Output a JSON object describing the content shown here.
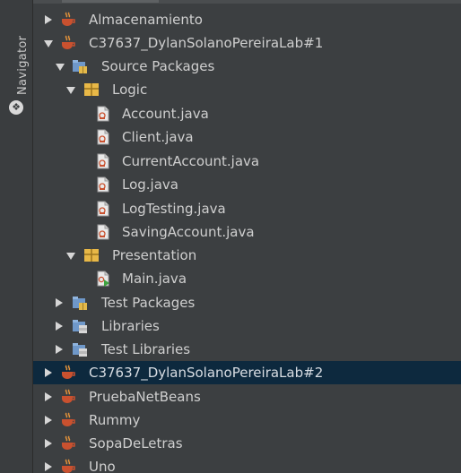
{
  "sidebar": {
    "navigator_label": "Navigator",
    "navigator_icon": "navigator-icon"
  },
  "tree": {
    "selected_color": "#0d293e",
    "items": [
      {
        "label": "Almacenamiento",
        "icon": "coffee-cup-icon",
        "expanded": false,
        "selected": false
      },
      {
        "label": "C37637_DylanSolanoPereiraLab#1",
        "icon": "coffee-cup-icon",
        "expanded": true,
        "selected": false
      },
      {
        "label": "Source Packages",
        "icon": "source-packages-icon",
        "expanded": true,
        "selected": false
      },
      {
        "label": "Logic",
        "icon": "package-icon",
        "expanded": true,
        "selected": false
      },
      {
        "label": "Account.java",
        "icon": "java-file-icon",
        "selected": false
      },
      {
        "label": "Client.java",
        "icon": "java-file-icon",
        "selected": false
      },
      {
        "label": "CurrentAccount.java",
        "icon": "java-file-icon",
        "selected": false
      },
      {
        "label": "Log.java",
        "icon": "java-file-icon",
        "selected": false
      },
      {
        "label": "LogTesting.java",
        "icon": "java-file-icon",
        "selected": false
      },
      {
        "label": "SavingAccount.java",
        "icon": "java-file-icon",
        "selected": false
      },
      {
        "label": "Presentation",
        "icon": "package-icon",
        "expanded": true,
        "selected": false
      },
      {
        "label": "Main.java",
        "icon": "java-main-file-icon",
        "selected": false
      },
      {
        "label": "Test Packages",
        "icon": "test-packages-icon",
        "expanded": false,
        "selected": false
      },
      {
        "label": "Libraries",
        "icon": "libraries-icon",
        "expanded": false,
        "selected": false
      },
      {
        "label": "Test Libraries",
        "icon": "test-libraries-icon",
        "expanded": false,
        "selected": false
      },
      {
        "label": "C37637_DylanSolanoPereiraLab#2",
        "icon": "coffee-cup-icon",
        "expanded": false,
        "selected": true
      },
      {
        "label": "PruebaNetBeans",
        "icon": "coffee-cup-icon",
        "expanded": false,
        "selected": false
      },
      {
        "label": "Rummy",
        "icon": "coffee-cup-icon",
        "expanded": false,
        "selected": false
      },
      {
        "label": "SopaDeLetras",
        "icon": "coffee-cup-icon",
        "expanded": false,
        "selected": false
      },
      {
        "label": "Uno",
        "icon": "coffee-cup-icon",
        "expanded": false,
        "selected": false
      }
    ]
  }
}
